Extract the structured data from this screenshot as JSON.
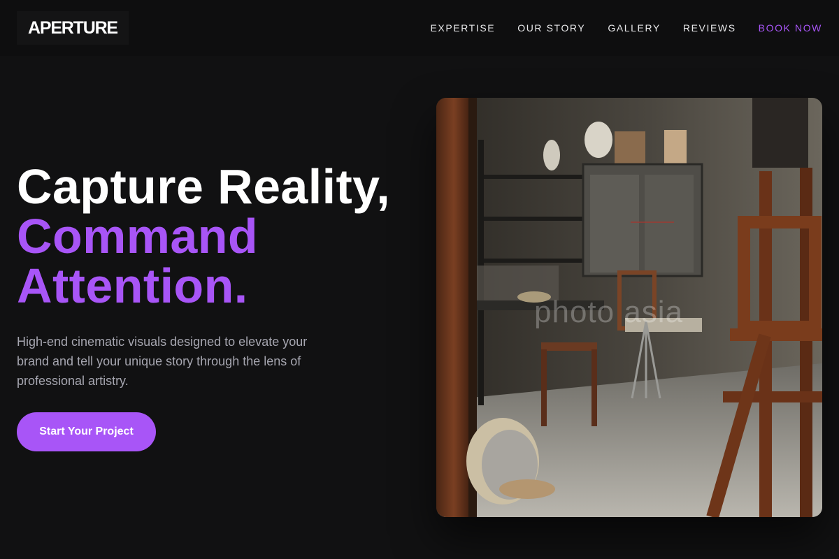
{
  "brand": {
    "logo": "APERTURE"
  },
  "nav": {
    "items": [
      {
        "label": "EXPERTISE"
      },
      {
        "label": "OUR STORY"
      },
      {
        "label": "GALLERY"
      },
      {
        "label": "REVIEWS"
      }
    ],
    "cta": "BOOK NOW"
  },
  "hero": {
    "headline_line1": "Capture Reality,",
    "headline_line2": "Command",
    "headline_line3": "Attention.",
    "subtitle": "High-end cinematic visuals designed to elevate your brand and tell your unique story through the lens of professional artistry.",
    "button_label": "Start Your Project",
    "image_watermark": "photo asia"
  },
  "colors": {
    "accent": "#a855f7",
    "background": "#111112",
    "header": "#0e0e0f"
  }
}
